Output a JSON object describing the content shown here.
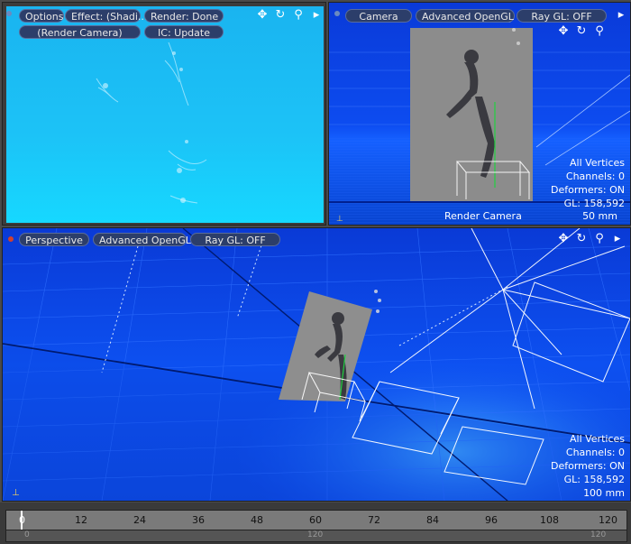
{
  "top_left_viewport": {
    "options_label": "Options",
    "effect_label": "Effect: (Shadi...",
    "render_label": "Render: Done",
    "camera_label": "(Render Camera)",
    "ic_label": "IC: Update"
  },
  "top_right_viewport": {
    "camera_label": "Camera",
    "opengl_label": "Advanced OpenGL",
    "raygl_label": "Ray GL: OFF",
    "stats": [
      "All Vertices",
      "Channels: 0",
      "Deformers: ON",
      "GL: 158,592"
    ],
    "footer_center": "Render Camera",
    "footer_right": "50 mm"
  },
  "bottom_viewport": {
    "view_label": "Perspective",
    "opengl_label": "Advanced OpenGL",
    "raygl_label": "Ray GL: OFF",
    "stats": [
      "All Vertices",
      "Channels: 0",
      "Deformers: ON",
      "GL: 158,592",
      "100 mm"
    ]
  },
  "timeline": {
    "ticks": [
      "0",
      "12",
      "24",
      "36",
      "48",
      "60",
      "72",
      "84",
      "96",
      "108",
      "120"
    ],
    "sub_ticks": [
      "0",
      "120",
      "120"
    ]
  },
  "icons": [
    "move-icon",
    "rotate-icon",
    "zoom-icon",
    "expand-arrow-icon",
    "axis-icon"
  ],
  "colors": {
    "viewport_blue": "#1466ff",
    "render_cyan": "#22ccff",
    "pill_bg": "#2c3e6a"
  }
}
